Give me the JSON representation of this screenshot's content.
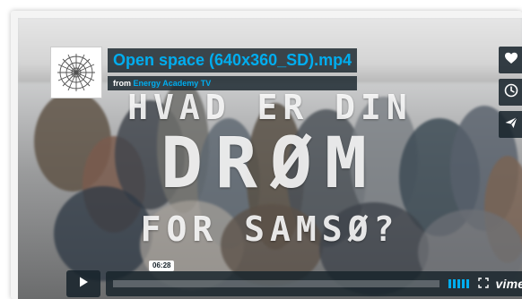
{
  "video": {
    "title": "Open space (640x360_SD).mp4",
    "from_label": "from",
    "owner": "Energy Academy TV",
    "overlay_lines": [
      "HVAD ER DIN",
      "DRØM",
      "FOR SAMSØ?"
    ]
  },
  "player": {
    "time": "06:28",
    "progress_fraction": 0,
    "brand": "vimeo",
    "volume_level_fraction": 1
  },
  "icons": {
    "avatar": "radial-sunburst-icon",
    "like": "heart-icon",
    "watch_later": "clock-icon",
    "share": "paper-plane-icon",
    "play": "play-icon",
    "fullscreen": "fullscreen-icon"
  },
  "colors": {
    "accent": "#00adef",
    "panel": "#17232b",
    "text": "#ffffff"
  }
}
